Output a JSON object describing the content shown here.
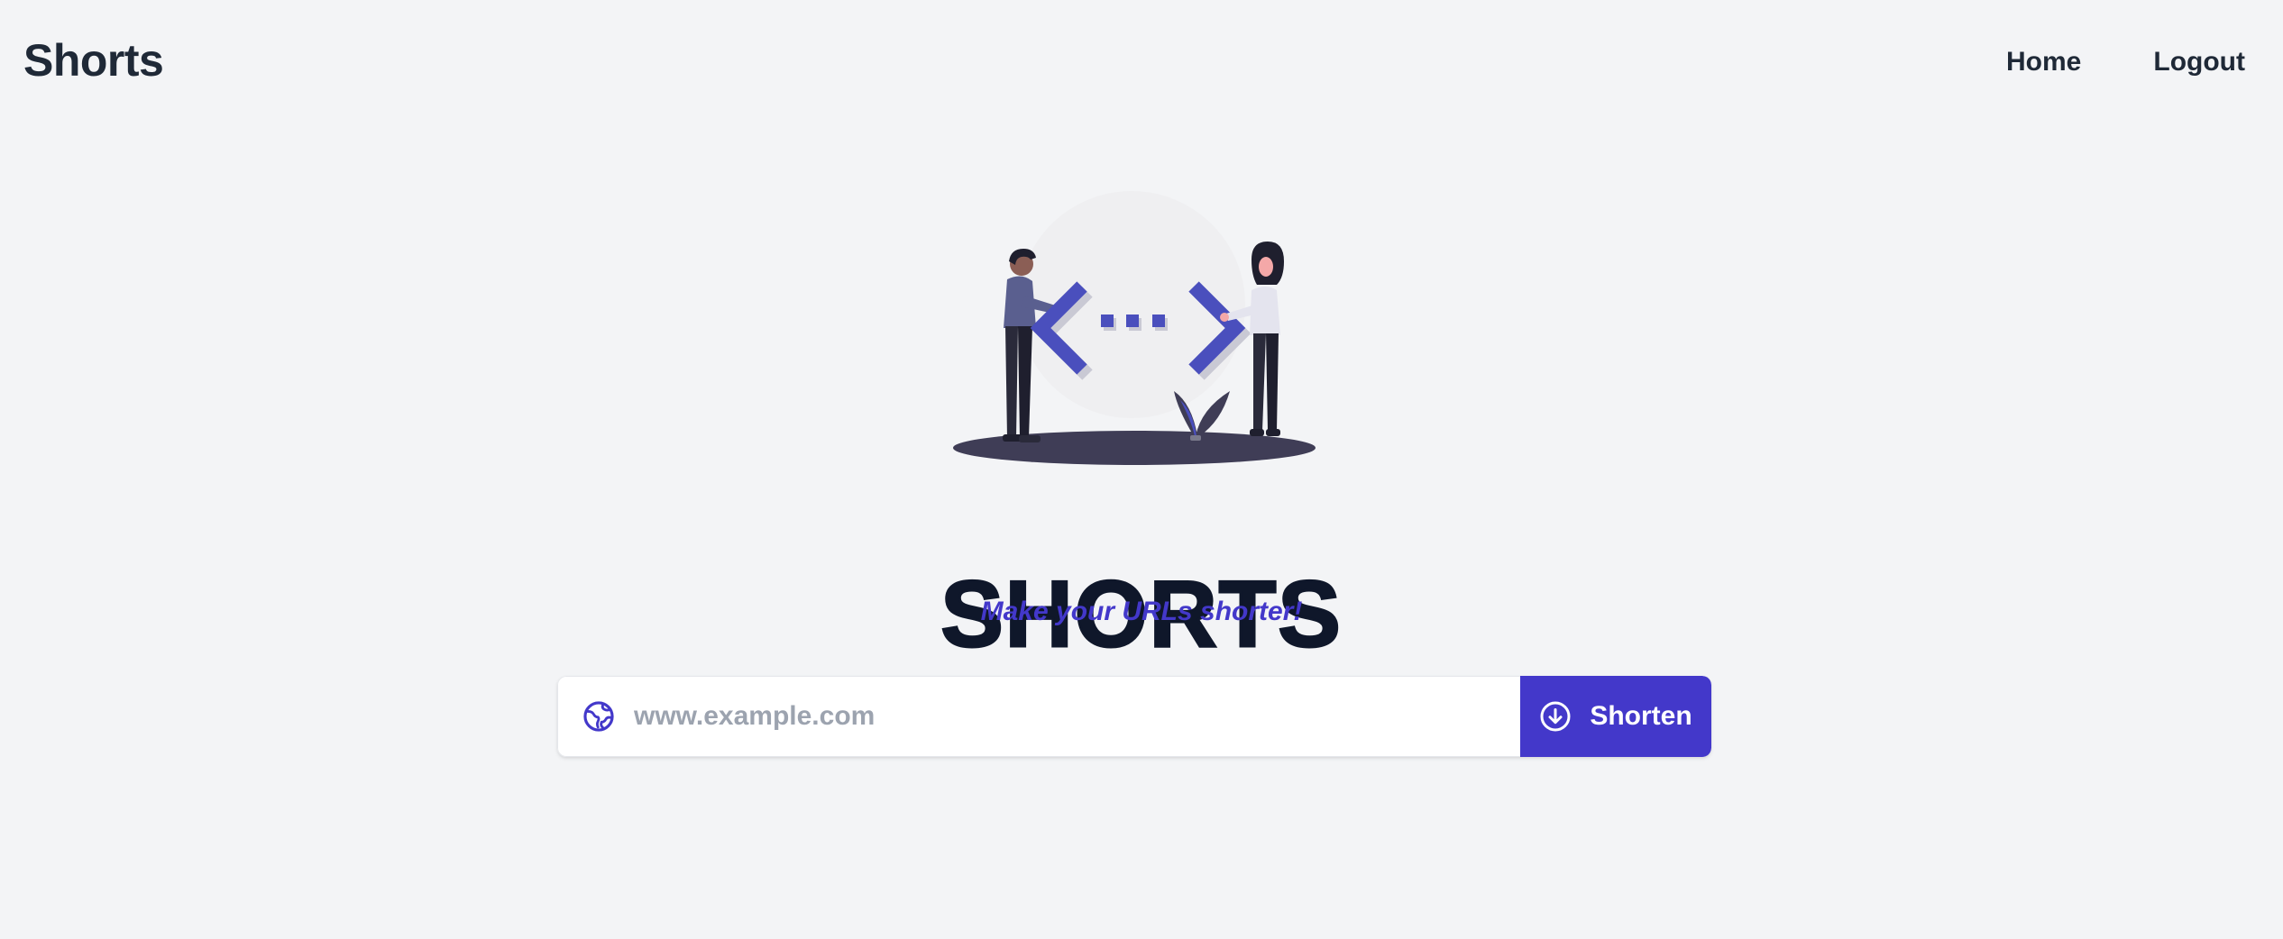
{
  "header": {
    "brand": "Shorts",
    "nav": {
      "home": "Home",
      "logout": "Logout"
    }
  },
  "hero": {
    "illustration": "people-with-code-brackets-illustration",
    "title": "SHORTS",
    "subtitle": "Make your URLs shorter!"
  },
  "form": {
    "url_placeholder": "www.example.com",
    "url_value": "",
    "url_icon": "globe-icon",
    "button_label": "Shorten",
    "button_icon": "arrow-down-circle-icon"
  },
  "colors": {
    "background": "#f3f4f6",
    "accent": "#4338ca",
    "text": "#1f2937",
    "title": "#0f172a"
  }
}
